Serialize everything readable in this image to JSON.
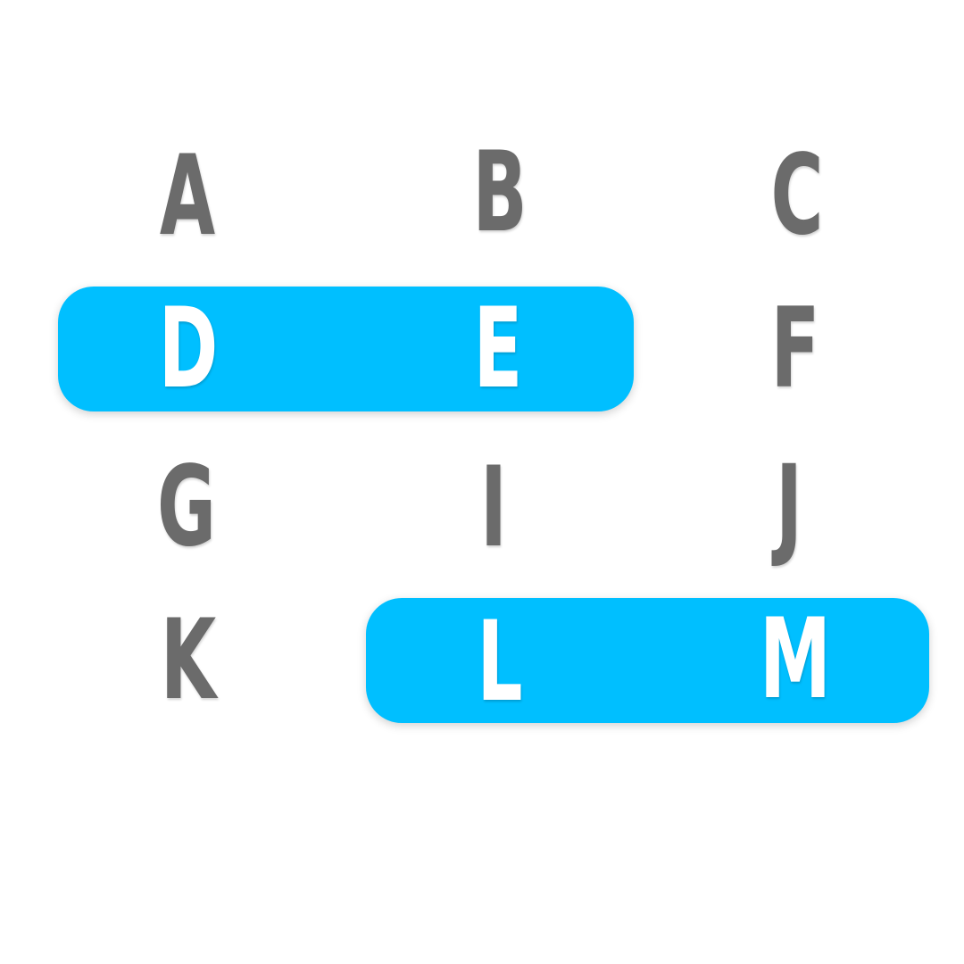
{
  "colors": {
    "highlight": "#00bfff",
    "letter": "#6b6b6b",
    "letter_selected": "#ffffff",
    "background": "#ffffff"
  },
  "grid": [
    [
      {
        "letter": "A",
        "selected": false
      },
      {
        "letter": "B",
        "selected": false
      },
      {
        "letter": "C",
        "selected": false
      }
    ],
    [
      {
        "letter": "D",
        "selected": true
      },
      {
        "letter": "E",
        "selected": true
      },
      {
        "letter": "F",
        "selected": false
      }
    ],
    [
      {
        "letter": "G",
        "selected": false
      },
      {
        "letter": "I",
        "selected": false
      },
      {
        "letter": "J",
        "selected": false
      }
    ],
    [
      {
        "letter": "K",
        "selected": false
      },
      {
        "letter": "L",
        "selected": true
      },
      {
        "letter": "M",
        "selected": true
      }
    ]
  ],
  "selections": [
    {
      "row": 1,
      "from_col": 0,
      "to_col": 1
    },
    {
      "row": 3,
      "from_col": 1,
      "to_col": 2
    }
  ]
}
